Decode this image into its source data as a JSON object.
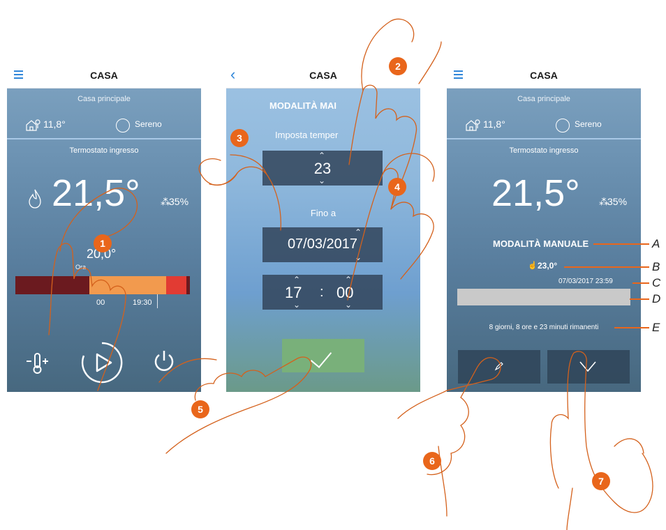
{
  "screen1": {
    "title": "CASA",
    "location": "Casa principale",
    "outdoor_temp": "11,8°",
    "weather": "Sereno",
    "thermostat": "Termostato ingresso",
    "temperature": "21,5°",
    "humidity": "35%",
    "setpoint": "20,0°",
    "time_label": "Ora",
    "tick_1": "00",
    "tick_2": "19:30"
  },
  "screen2": {
    "title": "CASA",
    "mode_title": "MODALITÀ MAI",
    "set_temp_label": "Imposta temper",
    "temp_value": "23",
    "until_label": "Fino a",
    "date_value": "07/03/2017",
    "hour_value": "17",
    "separator": ":",
    "minute_value": "00"
  },
  "screen3": {
    "title": "CASA",
    "location": "Casa principale",
    "outdoor_temp": "11,8°",
    "weather": "Sereno",
    "thermostat": "Termostato ingresso",
    "temperature": "21,5°",
    "humidity": "35%",
    "mode_label": "MODALITÀ MANUALE",
    "manual_setpoint": "23,0°",
    "end_datetime": "07/03/2017 23:59",
    "remaining": "8 giorni, 8 ore e 23 minuti rimanenti"
  },
  "callouts": {
    "steps": [
      "1",
      "2",
      "3",
      "4",
      "5",
      "6",
      "7"
    ],
    "letters": [
      "A",
      "B",
      "C",
      "D",
      "E"
    ]
  },
  "colors": {
    "accent": "#e9661b",
    "blue": "#2f86d9",
    "confirm": "#79b07a",
    "bar_dark": "#6b1a1f",
    "bar_orange": "#f29a4e",
    "bar_red": "#e23b33"
  },
  "icons": [
    "menu-icon",
    "back-icon",
    "house-tree-icon",
    "sun-icon",
    "flame-icon",
    "drop-icon",
    "thermometer-icon",
    "play-icon",
    "power-icon",
    "hand-icon",
    "pencil-icon",
    "close-icon",
    "check-icon",
    "chevron-up-icon",
    "chevron-down-icon"
  ]
}
